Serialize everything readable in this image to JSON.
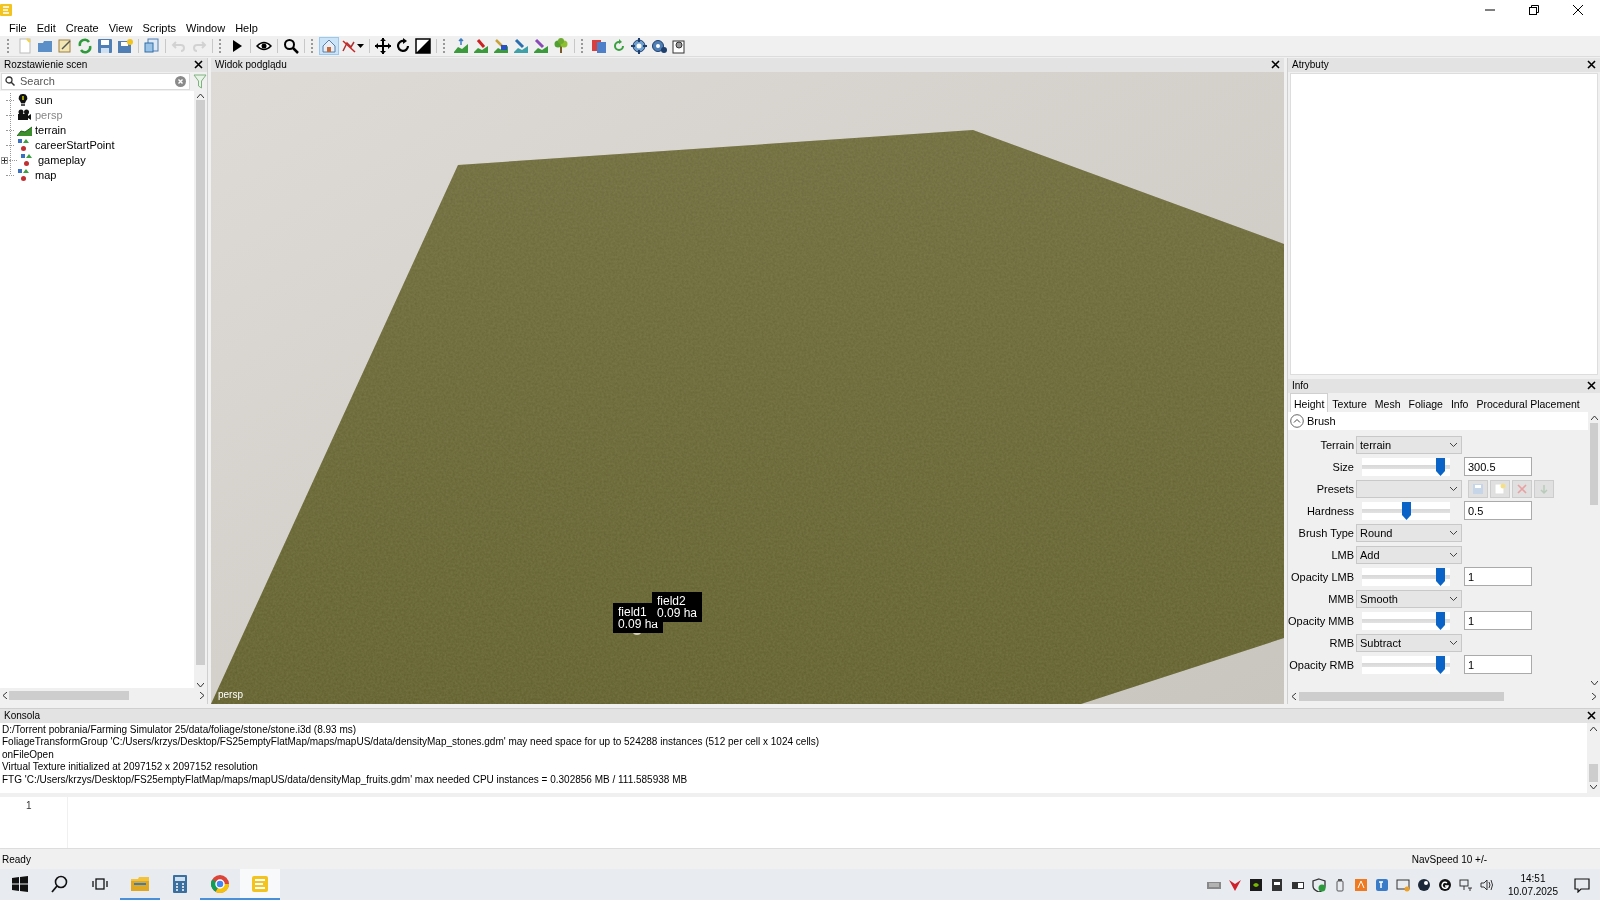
{
  "menu": [
    "File",
    "Edit",
    "Create",
    "View",
    "Scripts",
    "Window",
    "Help"
  ],
  "toolbar": [
    {
      "selected": false,
      "disabled": false
    },
    {
      "selected": false,
      "disabled": false
    },
    {
      "selected": false,
      "disabled": false
    },
    {
      "selected": false,
      "disabled": false
    },
    {
      "selected": false,
      "disabled": false
    },
    {
      "selected": false,
      "disabled": false
    },
    {
      "selected": false,
      "disabled": false
    },
    {
      "selected": false,
      "disabled": true
    },
    {
      "selected": false,
      "disabled": true
    },
    {
      "selected": false,
      "disabled": false
    },
    {
      "selected": false,
      "disabled": false
    },
    {
      "selected": false,
      "disabled": false
    },
    {
      "selected": true,
      "disabled": false
    },
    {
      "selected": false,
      "disabled": false
    },
    {
      "selected": false,
      "disabled": false
    },
    {
      "selected": false,
      "disabled": false
    },
    {
      "selected": false,
      "disabled": false
    },
    {
      "selected": false,
      "disabled": false
    },
    {
      "selected": false,
      "disabled": false
    },
    {
      "selected": false,
      "disabled": false
    },
    {
      "selected": false,
      "disabled": false
    },
    {
      "selected": false,
      "disabled": false
    },
    {
      "selected": false,
      "disabled": false
    },
    {
      "selected": false,
      "disabled": false
    },
    {
      "selected": false,
      "disabled": false
    },
    {
      "selected": false,
      "disabled": false
    },
    {
      "selected": false,
      "disabled": false
    },
    {
      "selected": false,
      "disabled": false
    }
  ],
  "scene_panel": {
    "title": "Rozstawienie scen",
    "search": {
      "placeholder": "Search"
    },
    "items": [
      {
        "label": "sun",
        "kind": "light",
        "hidden": false,
        "collapsed": false
      },
      {
        "label": "persp",
        "kind": "camera",
        "hidden": true,
        "collapsed": false
      },
      {
        "label": "terrain",
        "kind": "terrain",
        "hidden": false,
        "collapsed": false
      },
      {
        "label": "careerStartPoint",
        "kind": "transform",
        "hidden": false,
        "collapsed": false
      },
      {
        "label": "gameplay",
        "kind": "transform",
        "hidden": false,
        "collapsed": true
      },
      {
        "label": "map",
        "kind": "transform",
        "hidden": false,
        "collapsed": false
      }
    ]
  },
  "viewport": {
    "title": "Widok podglądu",
    "camera": "persp",
    "labels": [
      {
        "name": "field1",
        "area": "0.09 ha"
      },
      {
        "name": "field2",
        "area": "0.09 ha"
      }
    ]
  },
  "attributes_panel": {
    "title": "Atrybuty"
  },
  "info_panel": {
    "title": "Info",
    "tabs": [
      {
        "label": "Height",
        "selected": true
      },
      {
        "label": "Texture",
        "selected": false
      },
      {
        "label": "Mesh",
        "selected": false
      },
      {
        "label": "Foliage",
        "selected": false
      },
      {
        "label": "Info",
        "selected": false
      },
      {
        "label": "Procedural Placement",
        "selected": false
      }
    ],
    "section": {
      "title": "Brush",
      "expanded": true
    },
    "rows": [
      {
        "kind": "dropdown",
        "label": "Terrain",
        "value": "terrain"
      },
      {
        "kind": "slider",
        "label": "Size",
        "level": 0.92,
        "value": "300.5"
      },
      {
        "kind": "presets",
        "label": "Presets"
      },
      {
        "kind": "slider",
        "label": "Hardness",
        "level": 0.5,
        "value": "0.5"
      },
      {
        "kind": "dropdown",
        "label": "Brush Type",
        "value": "Round"
      },
      {
        "kind": "dropdown",
        "label": "LMB",
        "value": "Add"
      },
      {
        "kind": "slider",
        "label": "Opacity LMB",
        "level": 0.92,
        "value": "1"
      },
      {
        "kind": "dropdown",
        "label": "MMB",
        "value": "Smooth"
      },
      {
        "kind": "slider",
        "label": "Opacity MMB",
        "level": 0.92,
        "value": "1"
      },
      {
        "kind": "dropdown",
        "label": "RMB",
        "value": "Subtract"
      },
      {
        "kind": "slider",
        "label": "Opacity RMB",
        "level": 0.92,
        "value": "1"
      }
    ]
  },
  "console": {
    "title": "Konsola",
    "lines": [
      "D:/Torrent pobrania/Farming Simulator 25/data/foliage/stone/stone.i3d (8.93 ms)",
      "FoliageTransformGroup 'C:/Users/krzys/Desktop/FS25emptyFlatMap/maps/mapUS/data/densityMap_stones.gdm' may need space for up to 524288 instances (512 per cell x 1024 cells)",
      "onFileOpen",
      "Virtual Texture initialized at 2097152 x 2097152 resolution",
      "FTG 'C:/Users/krzys/Desktop/FS25emptyFlatMap/maps/mapUS/data/densityMap_fruits.gdm' max needed CPU instances = 0.302856 MB / 111.585938 MB"
    ],
    "line_numbers": [
      "1"
    ]
  },
  "status_bar": {
    "text": "Ready",
    "nav_speed": "NavSpeed 10 +/-"
  },
  "taskbar": {
    "apps": [
      {
        "running": true,
        "selected": false
      },
      {
        "running": false,
        "selected": false
      },
      {
        "running": true,
        "selected": false
      },
      {
        "running": true,
        "selected": true
      }
    ],
    "time": "14:51",
    "date": "10.07.2025"
  }
}
